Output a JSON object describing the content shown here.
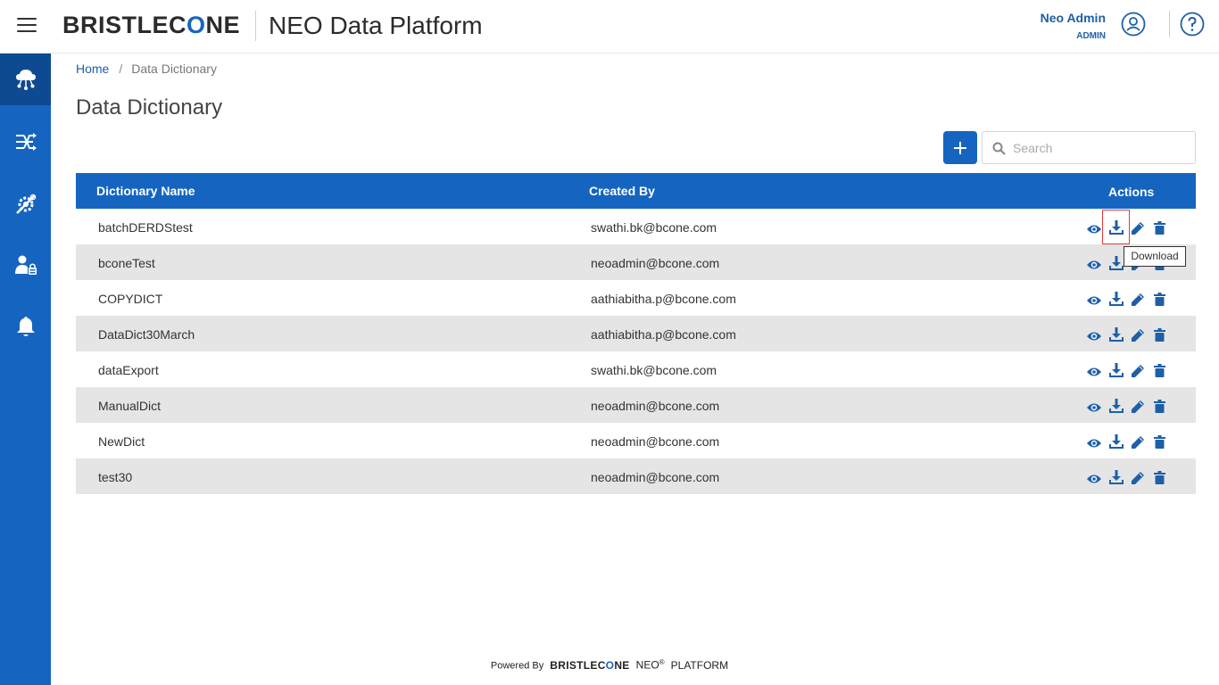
{
  "header": {
    "logo_prefix": "BRISTLEC",
    "logo_o": "O",
    "logo_suffix": "NE",
    "app_title": "NEO Data Platform",
    "user_name": "Neo Admin",
    "user_role": "ADMIN",
    "icons": [
      "menu-icon",
      "user-icon",
      "help-icon"
    ]
  },
  "sidebar": {
    "items": [
      {
        "icon": "cloud-network-icon",
        "active": true
      },
      {
        "icon": "shuffle-flow-icon",
        "active": false
      },
      {
        "icon": "gear-tools-icon",
        "active": false
      },
      {
        "icon": "user-lock-icon",
        "active": false
      },
      {
        "icon": "bell-icon",
        "active": false
      }
    ]
  },
  "breadcrumb": {
    "home": "Home",
    "separator": "/",
    "current": "Data Dictionary"
  },
  "page": {
    "title": "Data Dictionary"
  },
  "toolbar": {
    "add_icon": "plus-icon",
    "search_placeholder": "Search",
    "search_value": ""
  },
  "table": {
    "columns": [
      "Dictionary Name",
      "Created By",
      "Actions"
    ],
    "rows": [
      {
        "name": "batchDERDStest",
        "created_by": "swathi.bk@bcone.com"
      },
      {
        "name": "bconeTest",
        "created_by": "neoadmin@bcone.com"
      },
      {
        "name": "COPYDICT",
        "created_by": "aathiabitha.p@bcone.com"
      },
      {
        "name": "DataDict30March",
        "created_by": "aathiabitha.p@bcone.com"
      },
      {
        "name": "dataExport",
        "created_by": "swathi.bk@bcone.com"
      },
      {
        "name": "ManualDict",
        "created_by": "neoadmin@bcone.com"
      },
      {
        "name": "NewDict",
        "created_by": "neoadmin@bcone.com"
      },
      {
        "name": "test30",
        "created_by": "neoadmin@bcone.com"
      }
    ],
    "action_icons": [
      "eye-icon",
      "download-icon",
      "pencil-icon",
      "trash-icon"
    ]
  },
  "tooltip": {
    "text": "Download"
  },
  "footer": {
    "powered_by": "Powered By",
    "brand_prefix": "BRISTLEC",
    "brand_o": "O",
    "brand_suffix": "NE",
    "neo": "NEO",
    "registered": "®",
    "platform": "PLATFORM"
  },
  "colors": {
    "primary": "#1565c0",
    "sidebar_active": "#0d4a91",
    "row_alt": "#e5e5e5",
    "highlight": "#e53935"
  }
}
